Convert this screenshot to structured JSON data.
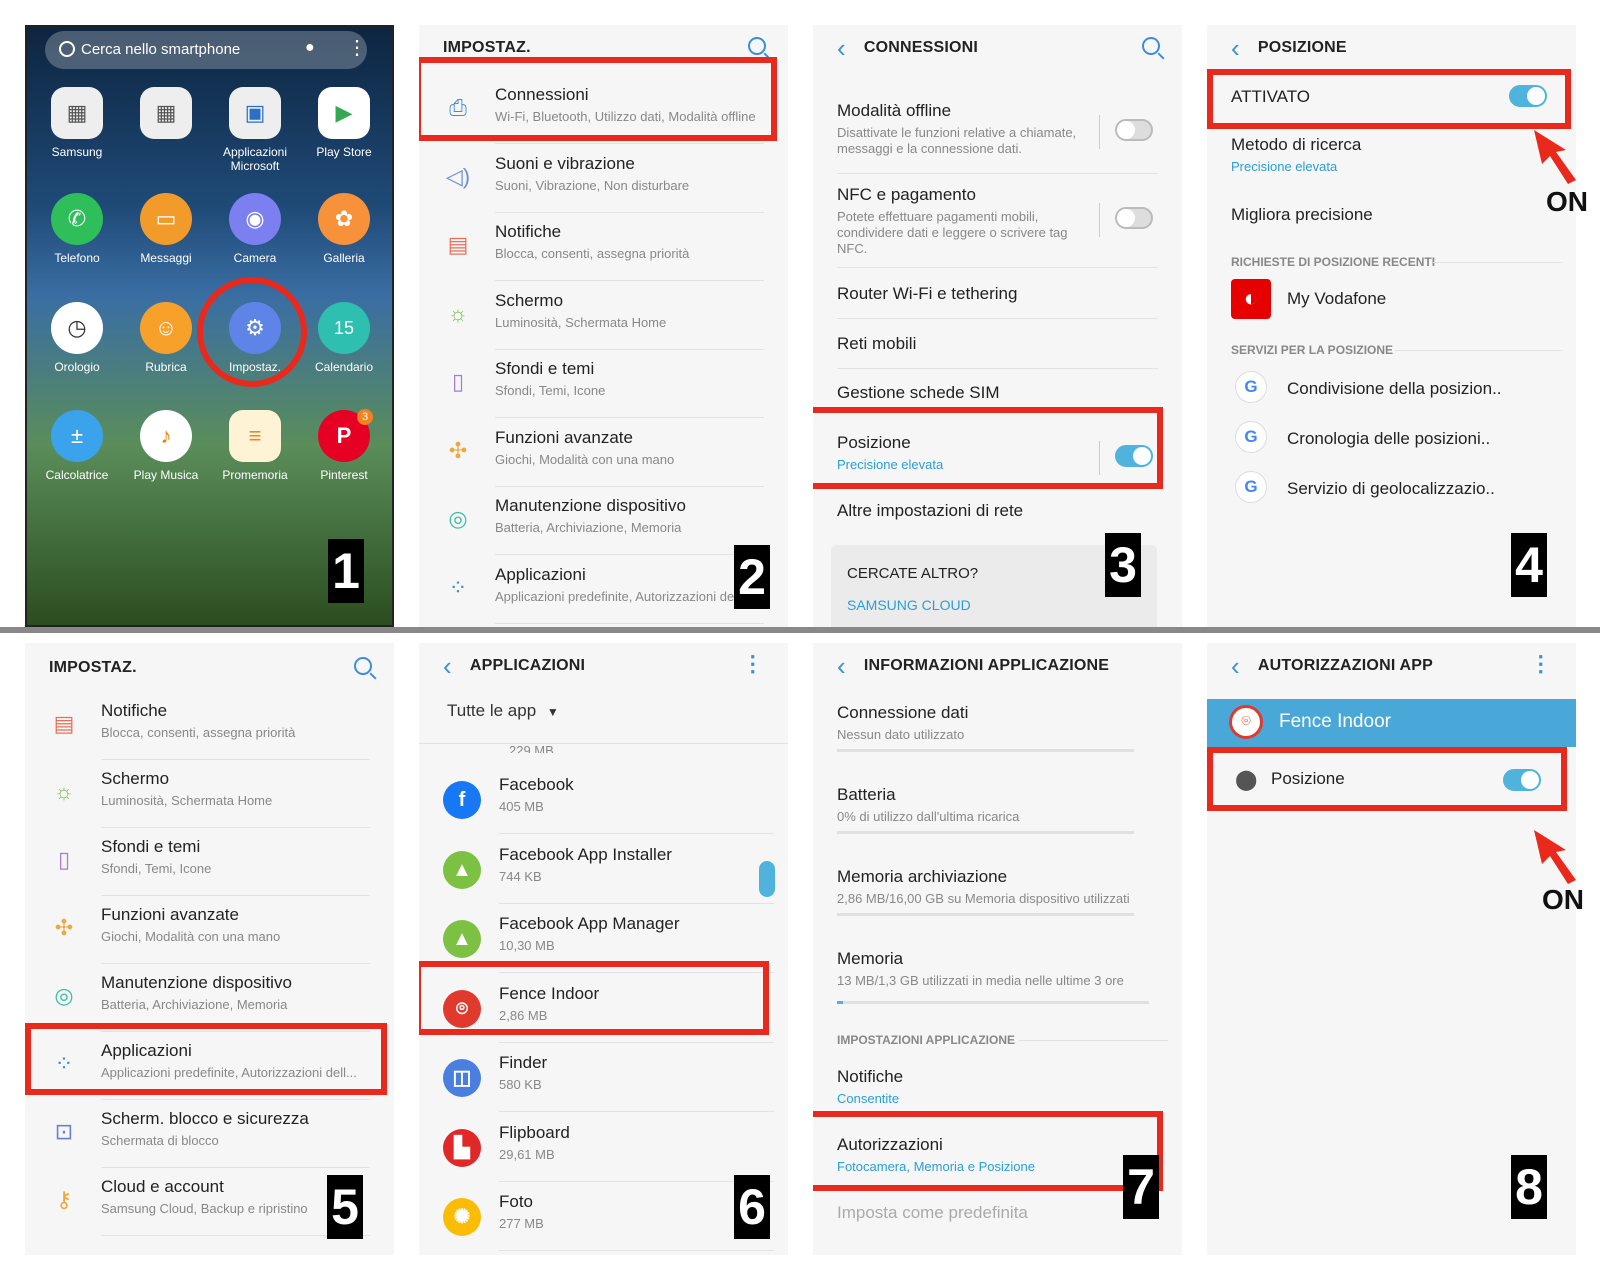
{
  "p1": {
    "search_placeholder": "Cerca nello smartphone",
    "apps": [
      "Samsung",
      "Applicazioni Microsoft",
      "Play Store",
      "Telefono",
      "Messaggi",
      "Camera",
      "Galleria",
      "Orologio",
      "Rubrica",
      "Impostaz.",
      "Calendario",
      "Calcolatrice",
      "Play Musica",
      "Promemoria",
      "Pinterest"
    ],
    "pinterest_badge": "3",
    "calendar_day": "15",
    "step": "1"
  },
  "p2": {
    "title": "IMPOSTAZ.",
    "items": [
      {
        "t": "Connessioni",
        "s": "Wi-Fi, Bluetooth, Utilizzo dati, Modalità offline"
      },
      {
        "t": "Suoni e vibrazione",
        "s": "Suoni, Vibrazione, Non disturbare"
      },
      {
        "t": "Notifiche",
        "s": "Blocca, consenti, assegna priorità"
      },
      {
        "t": "Schermo",
        "s": "Luminosità, Schermata Home"
      },
      {
        "t": "Sfondi e temi",
        "s": "Sfondi, Temi, Icone"
      },
      {
        "t": "Funzioni avanzate",
        "s": "Giochi, Modalità con una mano"
      },
      {
        "t": "Manutenzione dispositivo",
        "s": "Batteria, Archiviazione, Memoria"
      },
      {
        "t": "Applicazioni",
        "s": "Applicazioni predefinite, Autorizzazioni dell..."
      }
    ],
    "step": "2"
  },
  "p3": {
    "title": "CONNESSIONI",
    "offline_t": "Modalità offline",
    "offline_s1": "Disattivate le funzioni relative a chiamate,",
    "offline_s2": "messaggi e la connessione dati.",
    "nfc_t": "NFC e pagamento",
    "nfc_s1": "Potete effettuare pagamenti mobili,",
    "nfc_s2": "condividere dati e leggere o scrivere tag",
    "nfc_s3": "NFC.",
    "router": "Router Wi-Fi e tethering",
    "reti": "Reti mobili",
    "sim": "Gestione schede SIM",
    "pos_t": "Posizione",
    "pos_s": "Precisione elevata",
    "altre": "Altre impostazioni di rete",
    "cercate": "CERCATE ALTRO?",
    "cloud": "SAMSUNG CLOUD",
    "step": "3"
  },
  "p4": {
    "title": "POSIZIONE",
    "attivato": "ATTIVATO",
    "metodo_t": "Metodo di ricerca",
    "metodo_s": "Precisione elevata",
    "migliora": "Migliora precisione",
    "sect1": "RICHIESTE DI POSIZIONE RECENTI",
    "vodafone": "My Vodafone",
    "sect2": "SERVIZI PER LA POSIZIONE",
    "svc": [
      "Condivisione della posizion..",
      "Cronologia delle posizioni..",
      "Servizio di geolocalizzazio.."
    ],
    "on": "ON",
    "step": "4"
  },
  "p5": {
    "title": "IMPOSTAZ.",
    "items": [
      {
        "t": "Notifiche",
        "s": "Blocca, consenti, assegna priorità"
      },
      {
        "t": "Schermo",
        "s": "Luminosità, Schermata Home"
      },
      {
        "t": "Sfondi e temi",
        "s": "Sfondi, Temi, Icone"
      },
      {
        "t": "Funzioni avanzate",
        "s": "Giochi, Modalità con una mano"
      },
      {
        "t": "Manutenzione dispositivo",
        "s": "Batteria, Archiviazione, Memoria"
      },
      {
        "t": "Applicazioni",
        "s": "Applicazioni predefinite, Autorizzazioni dell..."
      },
      {
        "t": "Scherm. blocco e sicurezza",
        "s": "Schermata di blocco"
      },
      {
        "t": "Cloud e account",
        "s": "Samsung Cloud, Backup e ripristino"
      }
    ],
    "step": "5"
  },
  "p6": {
    "title": "APPLICAZIONI",
    "filter": "Tutte le app",
    "partial": "229 MB",
    "apps": [
      {
        "t": "Facebook",
        "s": "405 MB"
      },
      {
        "t": "Facebook App Installer",
        "s": "744 KB"
      },
      {
        "t": "Facebook App Manager",
        "s": "10,30 MB"
      },
      {
        "t": "Fence Indoor",
        "s": "2,86 MB"
      },
      {
        "t": "Finder",
        "s": "580 KB"
      },
      {
        "t": "Flipboard",
        "s": "29,61 MB"
      },
      {
        "t": "Foto",
        "s": "277 MB"
      }
    ],
    "step": "6"
  },
  "p7": {
    "title": "INFORMAZIONI APPLICAZIONE",
    "items": [
      {
        "t": "Connessione dati",
        "s": "Nessun dato utilizzato"
      },
      {
        "t": "Batteria",
        "s": "0% di utilizzo dall'ultima ricarica"
      },
      {
        "t": "Memoria archiviazione",
        "s": "2,86 MB/16,00 GB su Memoria dispositivo utilizzati"
      },
      {
        "t": "Memoria",
        "s": "13 MB/1,3 GB utilizzati in media nelle ultime 3 ore"
      }
    ],
    "sect": "IMPOSTAZIONI APPLICAZIONE",
    "notifiche_t": "Notifiche",
    "notifiche_s": "Consentite",
    "aut_t": "Autorizzazioni",
    "aut_s": "Fotocamera, Memoria e Posizione",
    "predef": "Imposta come predefinita",
    "step": "7"
  },
  "p8": {
    "title": "AUTORIZZAZIONI APP",
    "app": "Fence Indoor",
    "posizione": "Posizione",
    "on": "ON",
    "step": "8"
  },
  "colors": {
    "highlight": "#e8291c",
    "accent": "#3b8fd8",
    "toggle_on": "#4fb3de",
    "banner": "#4aa8d8"
  }
}
